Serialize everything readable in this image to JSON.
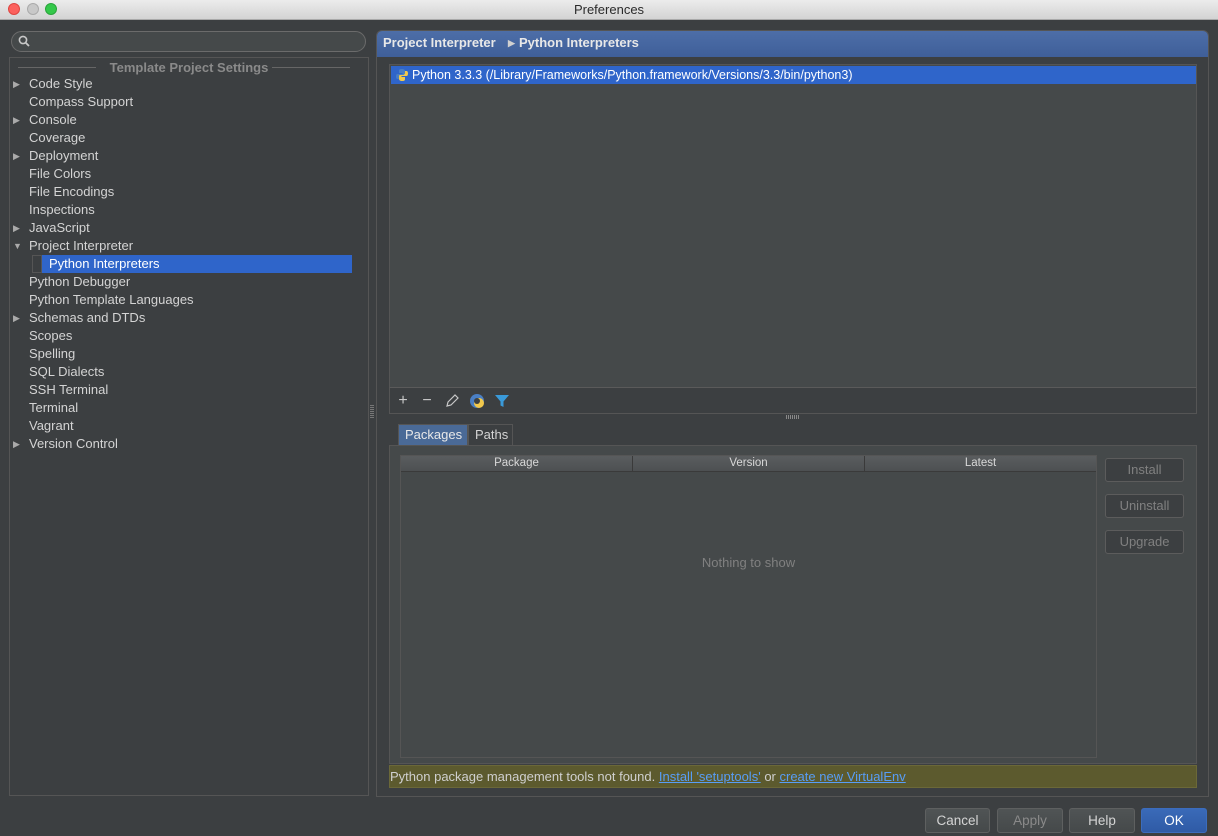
{
  "window": {
    "title": "Preferences"
  },
  "search": {
    "placeholder": ""
  },
  "sidebar": {
    "group_title": "Template Project Settings",
    "items": [
      {
        "label": "Code Style",
        "expandable": true
      },
      {
        "label": "Compass Support",
        "expandable": false
      },
      {
        "label": "Console",
        "expandable": true
      },
      {
        "label": "Coverage",
        "expandable": false
      },
      {
        "label": "Deployment",
        "expandable": true
      },
      {
        "label": "File Colors",
        "expandable": false
      },
      {
        "label": "File Encodings",
        "expandable": false
      },
      {
        "label": "Inspections",
        "expandable": false
      },
      {
        "label": "JavaScript",
        "expandable": true
      },
      {
        "label": "Project Interpreter",
        "expandable": true,
        "expanded": true
      },
      {
        "label": "Python Interpreters",
        "child": true,
        "selected": true
      },
      {
        "label": "Python Debugger",
        "expandable": false
      },
      {
        "label": "Python Template Languages",
        "expandable": false
      },
      {
        "label": "Schemas and DTDs",
        "expandable": true
      },
      {
        "label": "Scopes",
        "expandable": false
      },
      {
        "label": "Spelling",
        "expandable": false
      },
      {
        "label": "SQL Dialects",
        "expandable": false
      },
      {
        "label": "SSH Terminal",
        "expandable": false
      },
      {
        "label": "Terminal",
        "expandable": false
      },
      {
        "label": "Vagrant",
        "expandable": false
      },
      {
        "label": "Version Control",
        "expandable": true
      }
    ]
  },
  "main": {
    "breadcrumb": [
      "Project Interpreter",
      "Python Interpreters"
    ],
    "interpreters": [
      {
        "label": "Python 3.3.3 (/Library/Frameworks/Python.framework/Versions/3.3/bin/python3)",
        "selected": true
      }
    ],
    "toolbar_icons": [
      "add-icon",
      "remove-icon",
      "edit-icon",
      "python-icon",
      "filter-icon"
    ],
    "tabs": [
      {
        "label": "Packages",
        "active": true
      },
      {
        "label": "Paths",
        "active": false
      }
    ],
    "packages_table": {
      "columns": [
        "Package",
        "Version",
        "Latest"
      ],
      "rows": [],
      "empty_text": "Nothing to show"
    },
    "package_buttons": [
      "Install",
      "Uninstall",
      "Upgrade"
    ],
    "notice": {
      "text": "Python package management tools not found.",
      "link1": "Install 'setuptools'",
      "or": "or",
      "link2": "create new VirtualEnv"
    }
  },
  "footer": {
    "cancel": "Cancel",
    "apply": "Apply",
    "help": "Help",
    "ok": "OK"
  },
  "colors": {
    "selection": "#2f65ca",
    "header": "#4d6ea8",
    "notice_bg": "#5c5a2e",
    "link": "#589df6"
  }
}
